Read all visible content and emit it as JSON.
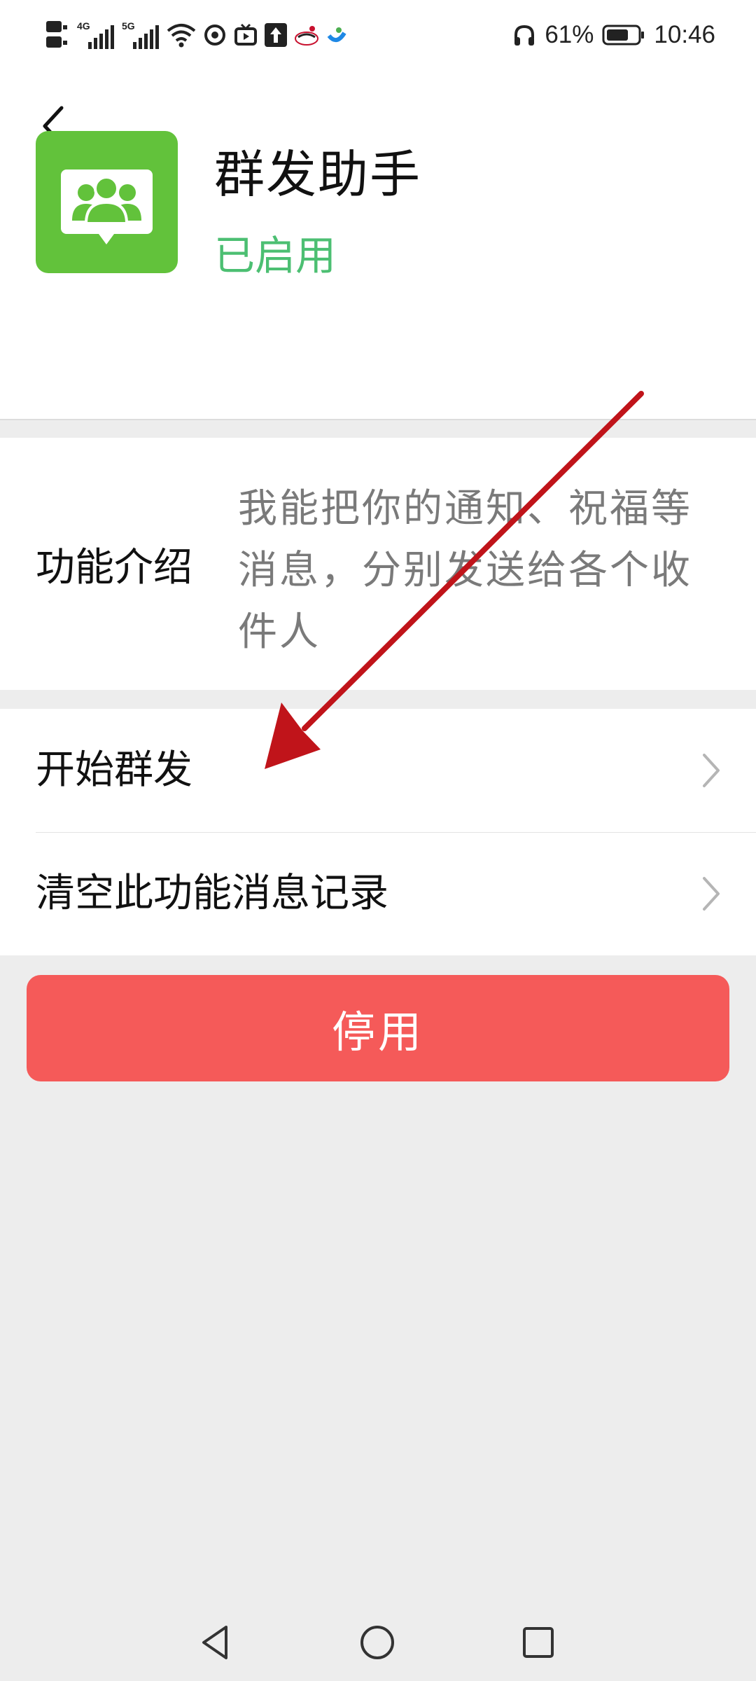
{
  "status_bar": {
    "indicators": [
      "HD",
      "4G",
      "5G"
    ],
    "battery_percent": "61%",
    "time": "10:46",
    "icons": [
      "hd-icon",
      "signal-icon",
      "wifi-icon",
      "weibo-icon",
      "video-icon",
      "upload-icon",
      "sina-icon",
      "app-icon",
      "headphone-icon",
      "battery-icon"
    ]
  },
  "header": {
    "app_name": "群发助手",
    "status": "已启用",
    "icon_color": "#62c23b",
    "status_color": "#4cbf72"
  },
  "intro": {
    "label": "功能介绍",
    "text": "我能把你的通知、祝福等消息，分别发送给各个收件人"
  },
  "menu": {
    "items": [
      {
        "label": "开始群发"
      },
      {
        "label": "清空此功能消息记录"
      }
    ]
  },
  "actions": {
    "disable_label": "停用",
    "disable_color": "#f55a59"
  },
  "annotation": {
    "arrow_color": "#c0141a"
  }
}
